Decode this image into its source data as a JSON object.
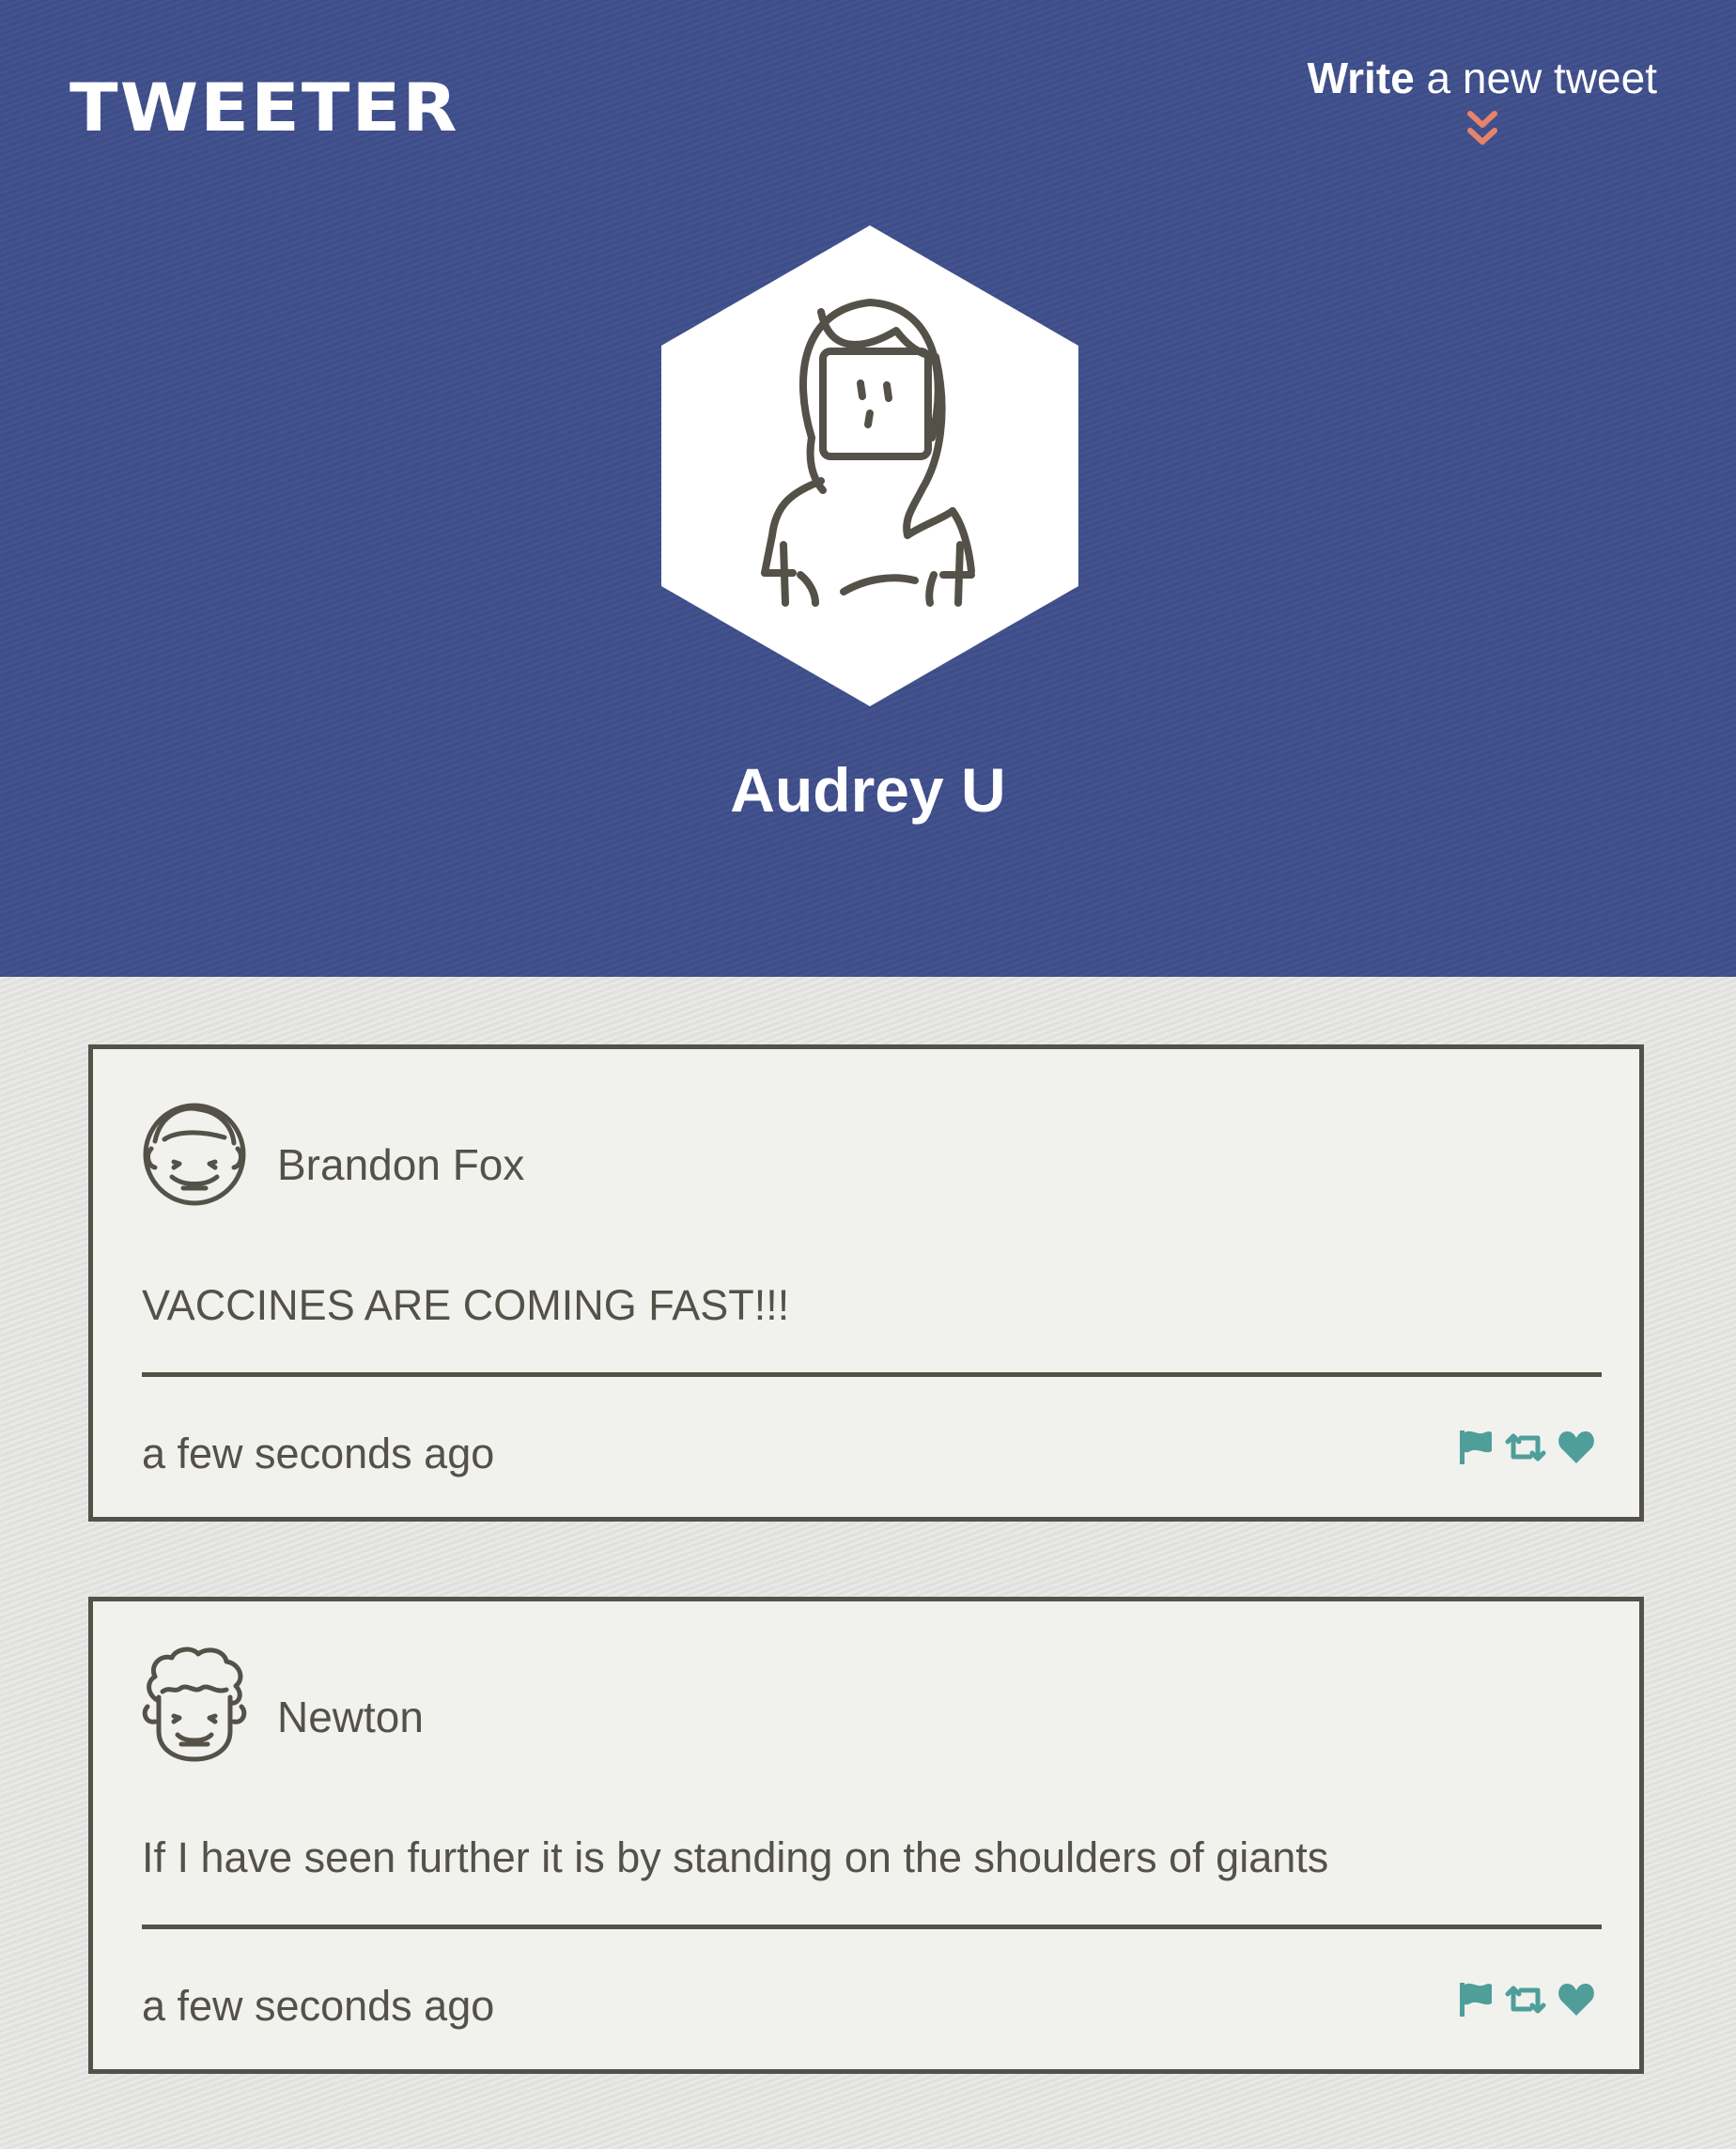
{
  "header": {
    "logo": "TWEETER",
    "compose_bold": "Write",
    "compose_rest": " a new tweet",
    "profile_name": "Audrey U",
    "accent_color": "#e8836b",
    "header_bg": "#3f4f8c"
  },
  "tweets": [
    {
      "author": "Brandon Fox",
      "content": "VACCINES ARE COMING FAST!!!",
      "time": "a few seconds ago",
      "avatar_icon": "smiling-face-avatar-icon"
    },
    {
      "author": "Newton",
      "content": "If I have seen further it is by standing on the shoulders of giants",
      "time": "a few seconds ago",
      "avatar_icon": "curly-hair-avatar-icon"
    }
  ],
  "icons": {
    "flag": "flag-icon",
    "retweet": "retweet-icon",
    "like": "heart-icon",
    "action_color": "#4f9e9a"
  }
}
